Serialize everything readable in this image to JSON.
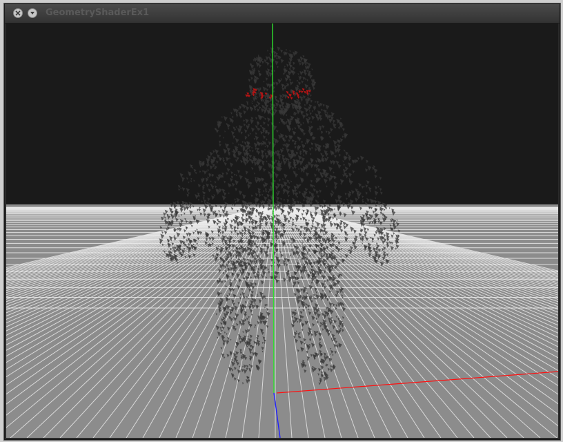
{
  "window": {
    "title": "GeometryShaderEx1"
  },
  "viewport": {
    "sky_color": "#1a1a1a",
    "ground_color": "#8c8c8c",
    "grid_line_color": "#eeeeee",
    "axis_colors": {
      "x": "#ff1010",
      "y": "#2ee02e",
      "z": "#2020ff"
    },
    "model_color": "#3a3a3a",
    "model_eye_color": "#b41414"
  }
}
